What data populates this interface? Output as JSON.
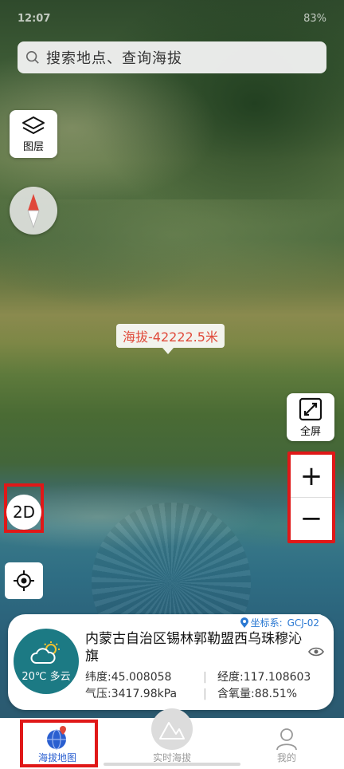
{
  "status_bar": {
    "time": "12:07",
    "battery": "83%"
  },
  "search": {
    "placeholder": "搜索地点、查询海拔"
  },
  "controls": {
    "layers_label": "图层",
    "fullscreen_label": "全屏",
    "zoom_in": "+",
    "zoom_out": "−",
    "mode_2d": "2D"
  },
  "map": {
    "elevation_label": "海拔-42222.5米"
  },
  "info_card": {
    "coord_system_label": "坐标系:",
    "coord_system_value": "GCJ-02",
    "weather": "20℃ 多云",
    "address": "内蒙古自治区锡林郭勒盟西乌珠穆沁旗",
    "latitude": "纬度:45.008058",
    "longitude": "经度:117.108603",
    "pressure": "气压:3417.98kPa",
    "oxygen": "含氧量:88.51%"
  },
  "bottom_nav": [
    {
      "label": "海拔地图",
      "icon": "globe-pin-icon"
    },
    {
      "label": "实时海拔",
      "icon": "mountain-icon"
    },
    {
      "label": "我的",
      "icon": "user-icon"
    }
  ],
  "colors": {
    "accent_red": "#e01818",
    "nav_active": "#2a5fd0",
    "elevation_text": "#e04a3a",
    "weather_bg": "#1c7a84"
  }
}
